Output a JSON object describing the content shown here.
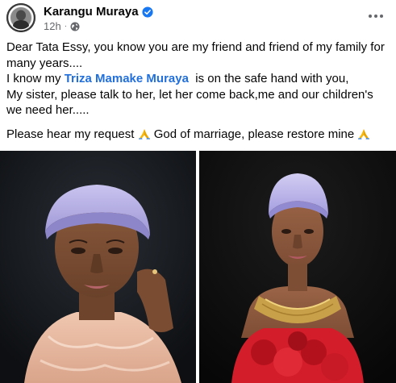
{
  "post": {
    "author": "Karangu Muraya",
    "timestamp": "12h",
    "separator": "·",
    "verified_icon": "verified-badge-icon",
    "audience_icon": "globe-icon",
    "menu_icon": "more-options-icon",
    "body": {
      "line1": "Dear Tata Essy, you know you are my friend and friend of my family for many years....",
      "line2_prefix": "I know my ",
      "mention": "Triza Mamake Muraya",
      "line2_suffix": "  is on the safe hand with you,",
      "line3": "My sister, please talk to her, let her come back,me and our children's we need her.....",
      "para2_a": "Please hear my request ",
      "para2_b": " God of marriage, please restore mine ",
      "emoji": "folded-hands-icon"
    },
    "photos": [
      {
        "name": "photo-woman-lavender-headwrap-pink-outfit"
      },
      {
        "name": "photo-woman-lavender-headwrap-gold-necklace-red-dress"
      }
    ]
  },
  "colors": {
    "link": "#216fdb",
    "verified": "#1877f2",
    "secondary_text": "#65676b"
  }
}
